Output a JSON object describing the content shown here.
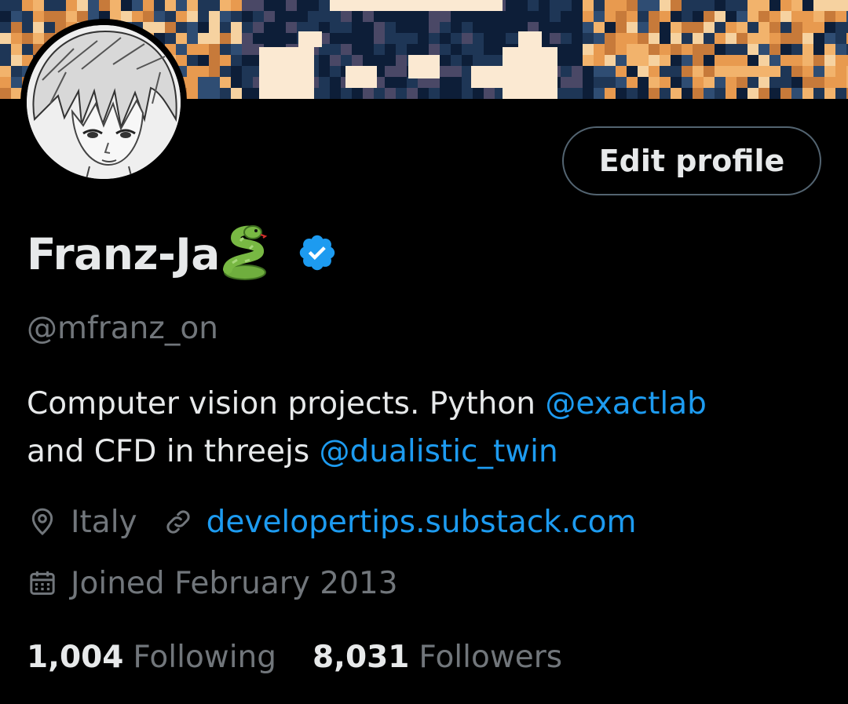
{
  "profile": {
    "display_name": "Franz-Ja",
    "handle": "@mfranz_on",
    "edit_button_label": "Edit profile",
    "bio": {
      "part1": "Computer vision projects. Python ",
      "mention1": "@exactlab",
      "part2": "and CFD in threejs ",
      "mention2": "@dualistic_twin"
    },
    "location": "Italy",
    "website": "developertips.substack.com",
    "joined": "Joined February 2013",
    "following_count": "1,004",
    "following_label": "Following",
    "followers_count": "8,031",
    "followers_label": "Followers"
  },
  "icons": {
    "name_emoji": "snake-emoji",
    "verified": "verified-badge-icon",
    "location": "map-pin-icon",
    "link": "link-icon",
    "calendar": "calendar-icon"
  },
  "colors": {
    "background": "#000000",
    "text_primary": "#e7e9ea",
    "text_secondary": "#71767b",
    "accent": "#1d9bf0",
    "button_border": "#536471"
  }
}
